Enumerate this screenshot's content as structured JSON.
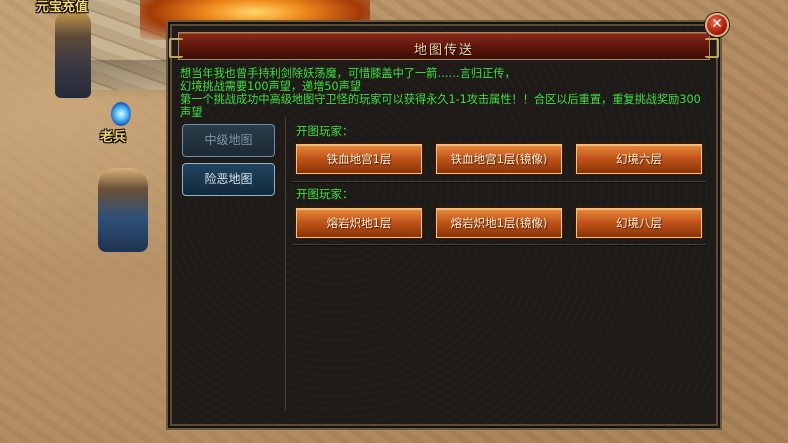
{
  "background": {
    "npc_top_label": "元宝充值",
    "npc_old_soldier": "老兵"
  },
  "dialog": {
    "title": "地图传送",
    "close_label": "✕",
    "intro_lines": [
      "想当年我也曾手持利剑除妖荡魔，可惜膝盖中了一箭……言归正传，",
      "幻境挑战需要100声望，递增50声望",
      "第一个挑战成功中高级地图守卫怪的玩家可以获得永久1-1攻击属性！！合区以后重置，重复挑战奖励300声望"
    ],
    "nav": [
      {
        "label": "中级地图",
        "active": false
      },
      {
        "label": "险恶地图",
        "active": true
      }
    ],
    "sections": [
      {
        "label": "开图玩家：",
        "buttons": [
          "铁血地宫1层",
          "铁血地宫1层(镜像)",
          "幻境六层"
        ]
      },
      {
        "label": "开图玩家：",
        "buttons": [
          "熔岩炽地1层",
          "熔岩炽地1层(镜像)",
          "幻境八层"
        ]
      }
    ]
  },
  "colors": {
    "text_green": "#3fe03f",
    "title_gold": "#f0d896",
    "button_orange": "#c2561b",
    "nav_blue": "#21445f"
  }
}
